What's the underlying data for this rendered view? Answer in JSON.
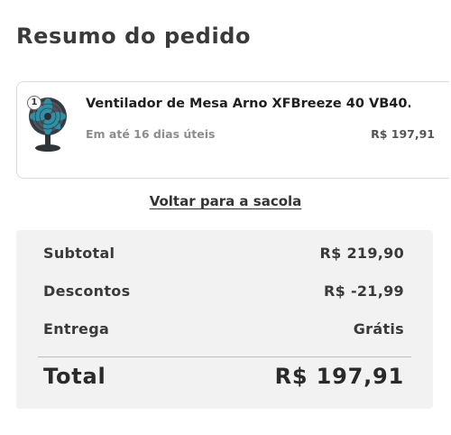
{
  "header": {
    "title": "Resumo do pedido"
  },
  "cart_item": {
    "quantity": "1",
    "name": "Ventilador de Mesa Arno XFBreeze 40 VB40...",
    "delivery": "Em até 16 dias úteis",
    "price": "R$ 197,91",
    "image_icon": "table-fan-icon"
  },
  "links": {
    "back_to_bag": "Voltar para a sacola"
  },
  "summary": {
    "subtotal_label": "Subtotal",
    "subtotal_value": "R$ 219,90",
    "discount_label": "Descontos",
    "discount_value": "R$ -21,99",
    "delivery_label": "Entrega",
    "delivery_value": "Grátis",
    "total_label": "Total",
    "total_value": "R$ 197,91"
  },
  "colors": {
    "summary_background": "#f2f2f2",
    "card_border": "#dcdcdc",
    "muted_text": "#8c8c8c"
  }
}
